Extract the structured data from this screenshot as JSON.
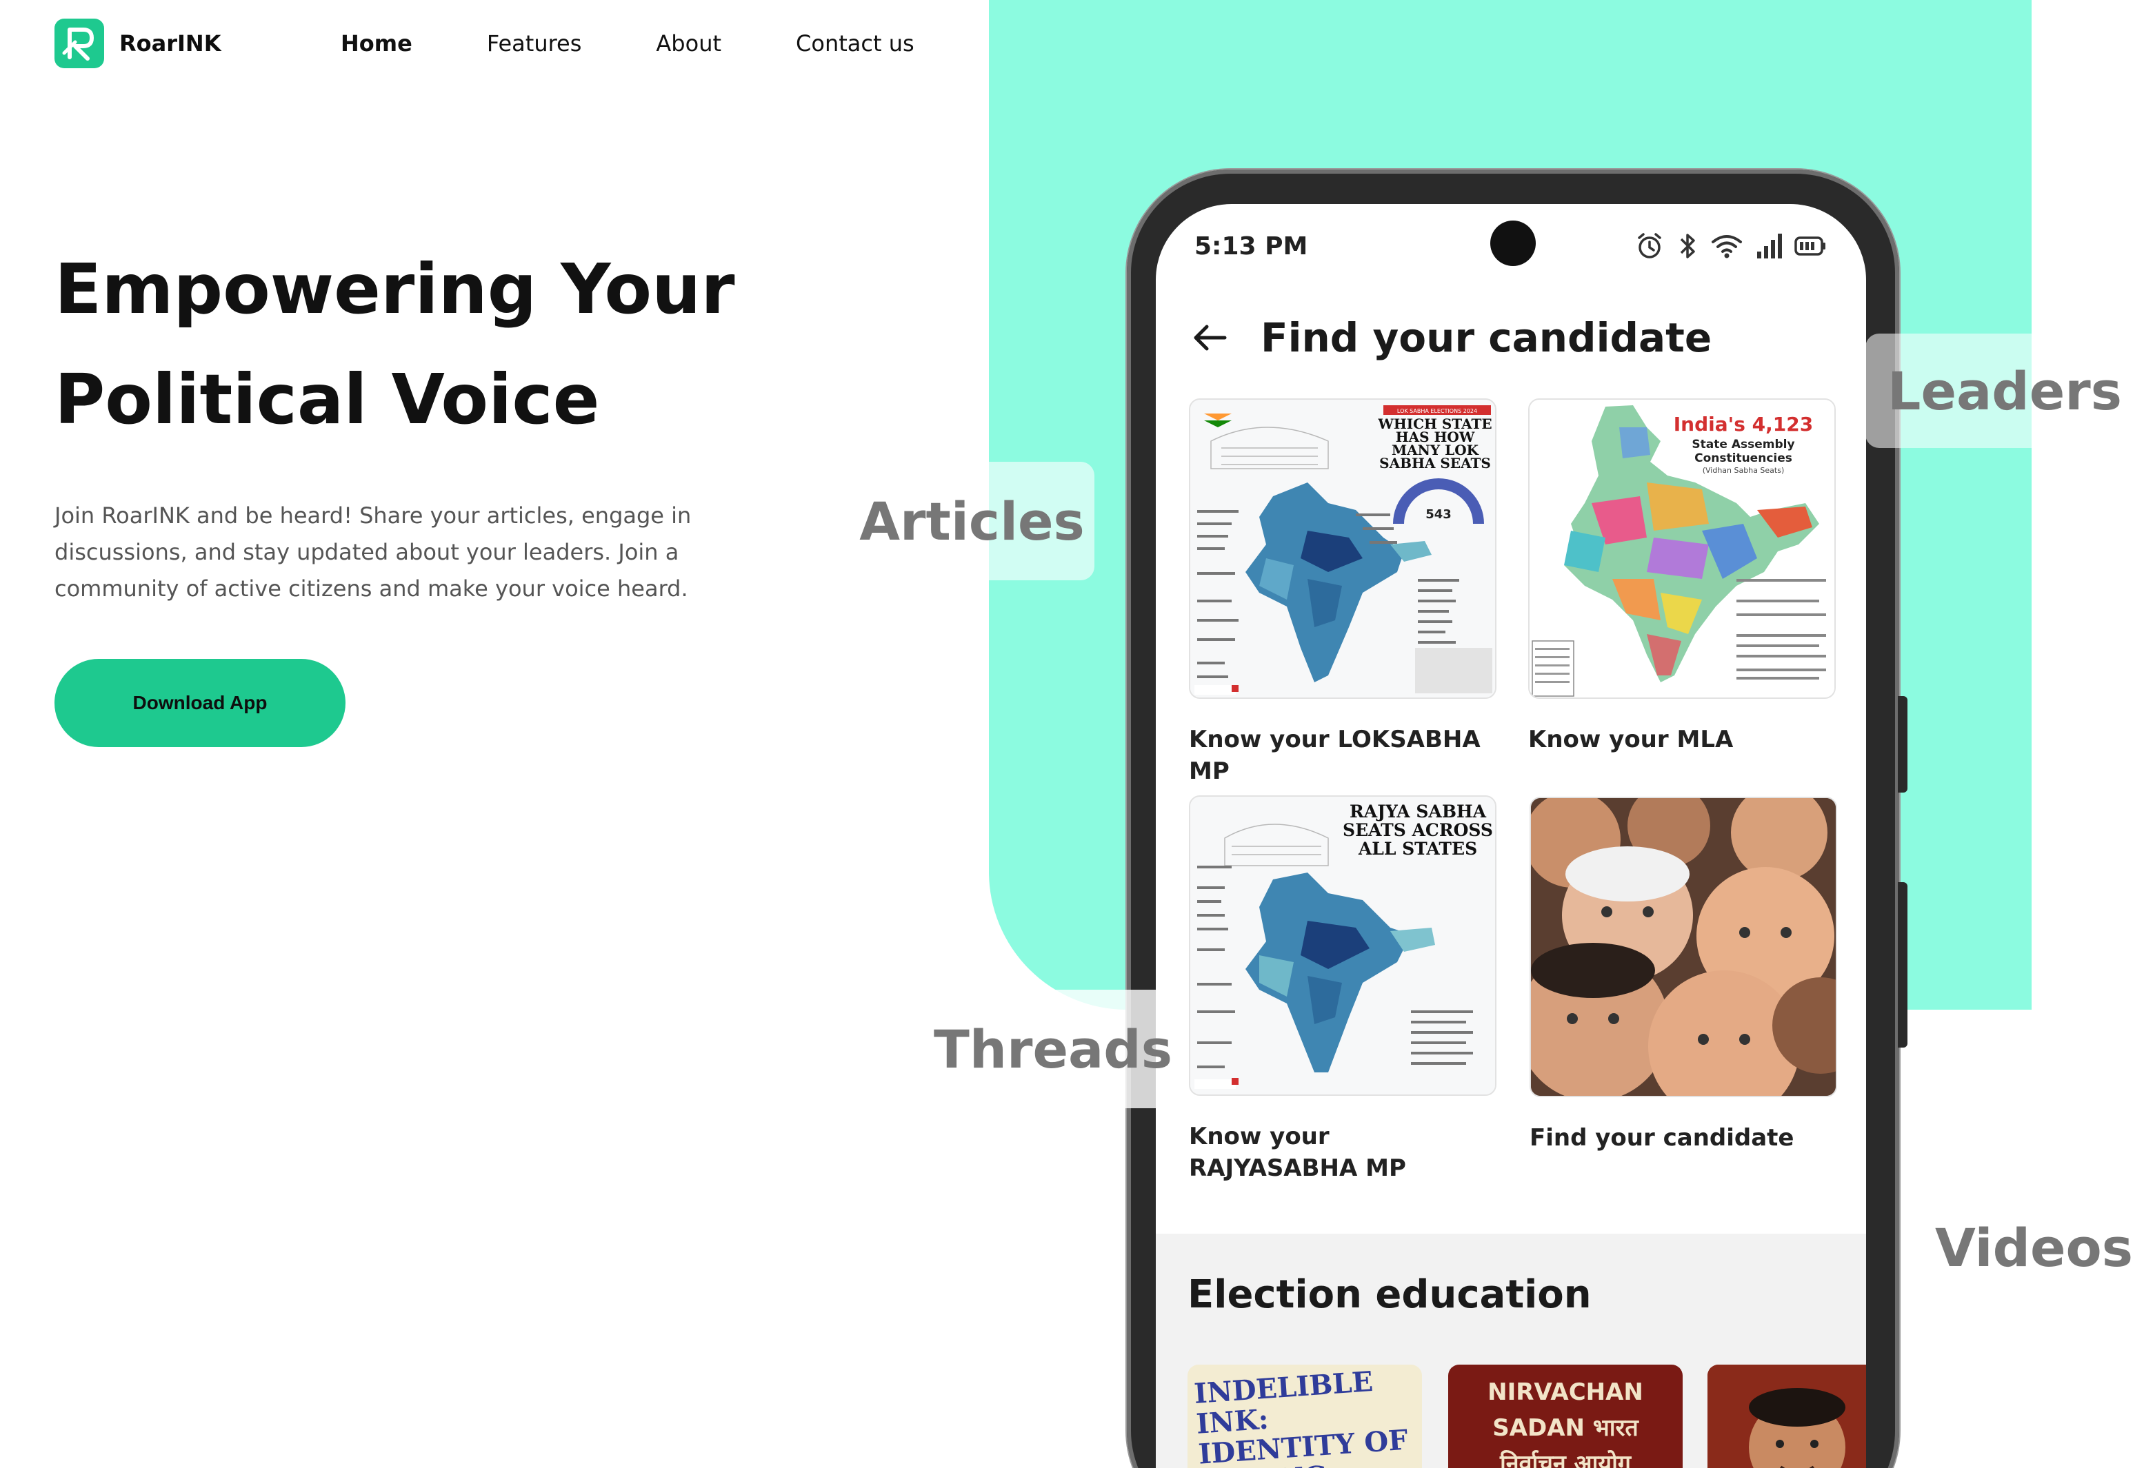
{
  "brand": {
    "name": "RoarINK",
    "logo_icon": "roarink-logo-icon",
    "accent": "#1ec98f",
    "mint": "#8cfbe0"
  },
  "nav": {
    "items": [
      {
        "label": "Home",
        "active": true
      },
      {
        "label": "Features",
        "active": false
      },
      {
        "label": "About",
        "active": false
      },
      {
        "label": "Contact us",
        "active": false
      }
    ]
  },
  "hero": {
    "title_line1": "Empowering Your",
    "title_line2": "Political Voice",
    "description": "Join RoarINK and be heard! Share your articles, engage in discussions, and stay updated about your leaders. Join a community of active citizens and make your voice heard.",
    "cta": "Download App"
  },
  "floating_labels": {
    "articles": "Articles",
    "leaders": "Leaders",
    "threads": "Threads",
    "videos": "Videos"
  },
  "phone": {
    "status_time": "5:13 PM",
    "status_icons": [
      "alarm-icon",
      "bluetooth-icon",
      "wifi-icon",
      "signal-icon",
      "battery-icon"
    ],
    "header_title": "Find your candidate",
    "back_icon": "back-arrow-icon",
    "cards": [
      {
        "label": "Know your LOKSABHA MP",
        "image_title": "WHICH STATE HAS HOW MANY LOK SABHA SEATS",
        "image_tag": "LOK SABHA ELECTIONS 2024",
        "image_count": "543"
      },
      {
        "label": "Know your MLA",
        "image_title": "India's 4,123",
        "image_subtitle": "State Assembly Constituencies",
        "image_note": "(Vidhan Sabha Seats)"
      },
      {
        "label": "Know your RAJYASABHA MP",
        "image_title": "RAJYA SABHA SEATS ACROSS ALL STATES"
      },
      {
        "label": "Find your candidate"
      }
    ],
    "section_title": "Election education",
    "edu_thumbs": [
      {
        "text": "INDELIBLE INK: IDENTITY OF VOTING"
      },
      {
        "text": "NIRVACHAN SADAN भारत निर्वाचन आयोग"
      },
      {
        "text": ""
      }
    ]
  }
}
